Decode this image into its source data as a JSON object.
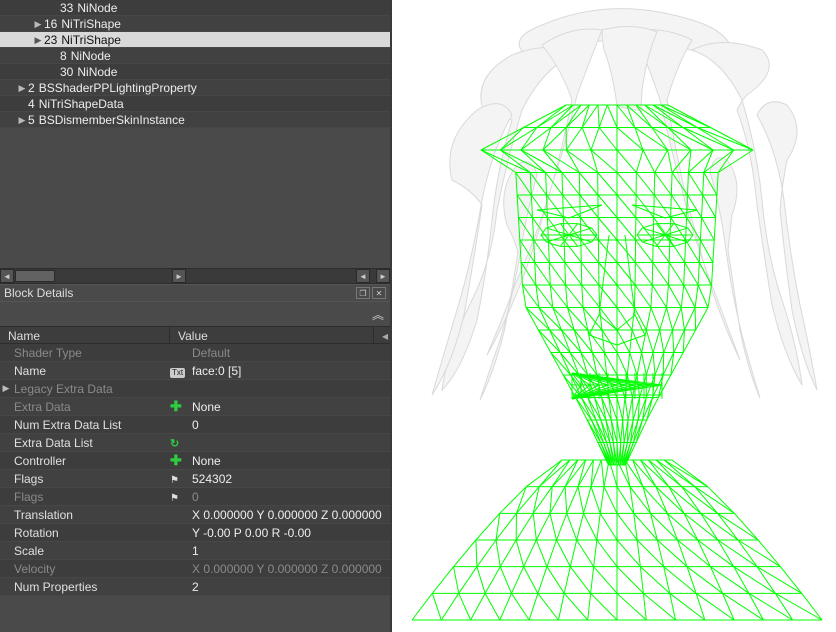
{
  "tree": {
    "items": [
      {
        "indent": 48,
        "id": "33",
        "label": "NiNode",
        "expandable": false,
        "selected": false
      },
      {
        "indent": 32,
        "id": "16",
        "label": "NiTriShape",
        "expandable": true,
        "selected": false
      },
      {
        "indent": 32,
        "id": "23",
        "label": "NiTriShape",
        "expandable": true,
        "selected": true
      },
      {
        "indent": 48,
        "id": "8",
        "label": "NiNode",
        "expandable": false,
        "selected": false
      },
      {
        "indent": 48,
        "id": "30",
        "label": "NiNode",
        "expandable": false,
        "selected": false
      },
      {
        "indent": 16,
        "id": "2",
        "label": "BSShaderPPLightingProperty",
        "expandable": true,
        "selected": false
      },
      {
        "indent": 16,
        "id": "4",
        "label": "NiTriShapeData",
        "expandable": false,
        "selected": false
      },
      {
        "indent": 16,
        "id": "5",
        "label": "BSDismemberSkinInstance",
        "expandable": true,
        "selected": false
      }
    ]
  },
  "block_details": {
    "title": "Block Details"
  },
  "columns": {
    "name": "Name",
    "value": "Value"
  },
  "props": [
    {
      "name": "Shader Type",
      "dim": true,
      "icon": "",
      "value": "Default",
      "vdim": true,
      "arrow": ""
    },
    {
      "name": "Name",
      "dim": false,
      "icon": "txt",
      "value": "face:0 [5]",
      "vdim": false,
      "arrow": ""
    },
    {
      "name": "Legacy Extra Data",
      "dim": true,
      "icon": "",
      "value": "",
      "vdim": false,
      "arrow": "▶"
    },
    {
      "name": "Extra Data",
      "dim": true,
      "icon": "plus",
      "value": "None",
      "vdim": false,
      "arrow": ""
    },
    {
      "name": "Num Extra Data List",
      "dim": false,
      "icon": "",
      "value": "0",
      "vdim": false,
      "arrow": ""
    },
    {
      "name": "Extra Data List",
      "dim": false,
      "icon": "refresh",
      "value": "",
      "vdim": false,
      "arrow": ""
    },
    {
      "name": "Controller",
      "dim": false,
      "icon": "plus",
      "value": "None",
      "vdim": false,
      "arrow": ""
    },
    {
      "name": "Flags",
      "dim": false,
      "icon": "flag",
      "value": "524302",
      "vdim": false,
      "arrow": ""
    },
    {
      "name": "Flags",
      "dim": true,
      "icon": "flag",
      "value": "0",
      "vdim": true,
      "arrow": ""
    },
    {
      "name": "Translation",
      "dim": false,
      "icon": "",
      "value": "X 0.000000 Y 0.000000 Z 0.000000",
      "vdim": false,
      "arrow": ""
    },
    {
      "name": "Rotation",
      "dim": false,
      "icon": "",
      "value": "Y -0.00 P 0.00 R -0.00",
      "vdim": false,
      "arrow": ""
    },
    {
      "name": "Scale",
      "dim": false,
      "icon": "",
      "value": "1",
      "vdim": false,
      "arrow": ""
    },
    {
      "name": "Velocity",
      "dim": true,
      "icon": "",
      "value": "X 0.000000 Y 0.000000 Z 0.000000",
      "vdim": true,
      "arrow": ""
    },
    {
      "name": "Num Properties",
      "dim": false,
      "icon": "",
      "value": "2",
      "vdim": false,
      "arrow": ""
    }
  ],
  "viewport": {
    "wireframe_color": "#00ff00",
    "hair_fill": "#f4f4f4",
    "hair_stroke": "#d9d9d9"
  }
}
